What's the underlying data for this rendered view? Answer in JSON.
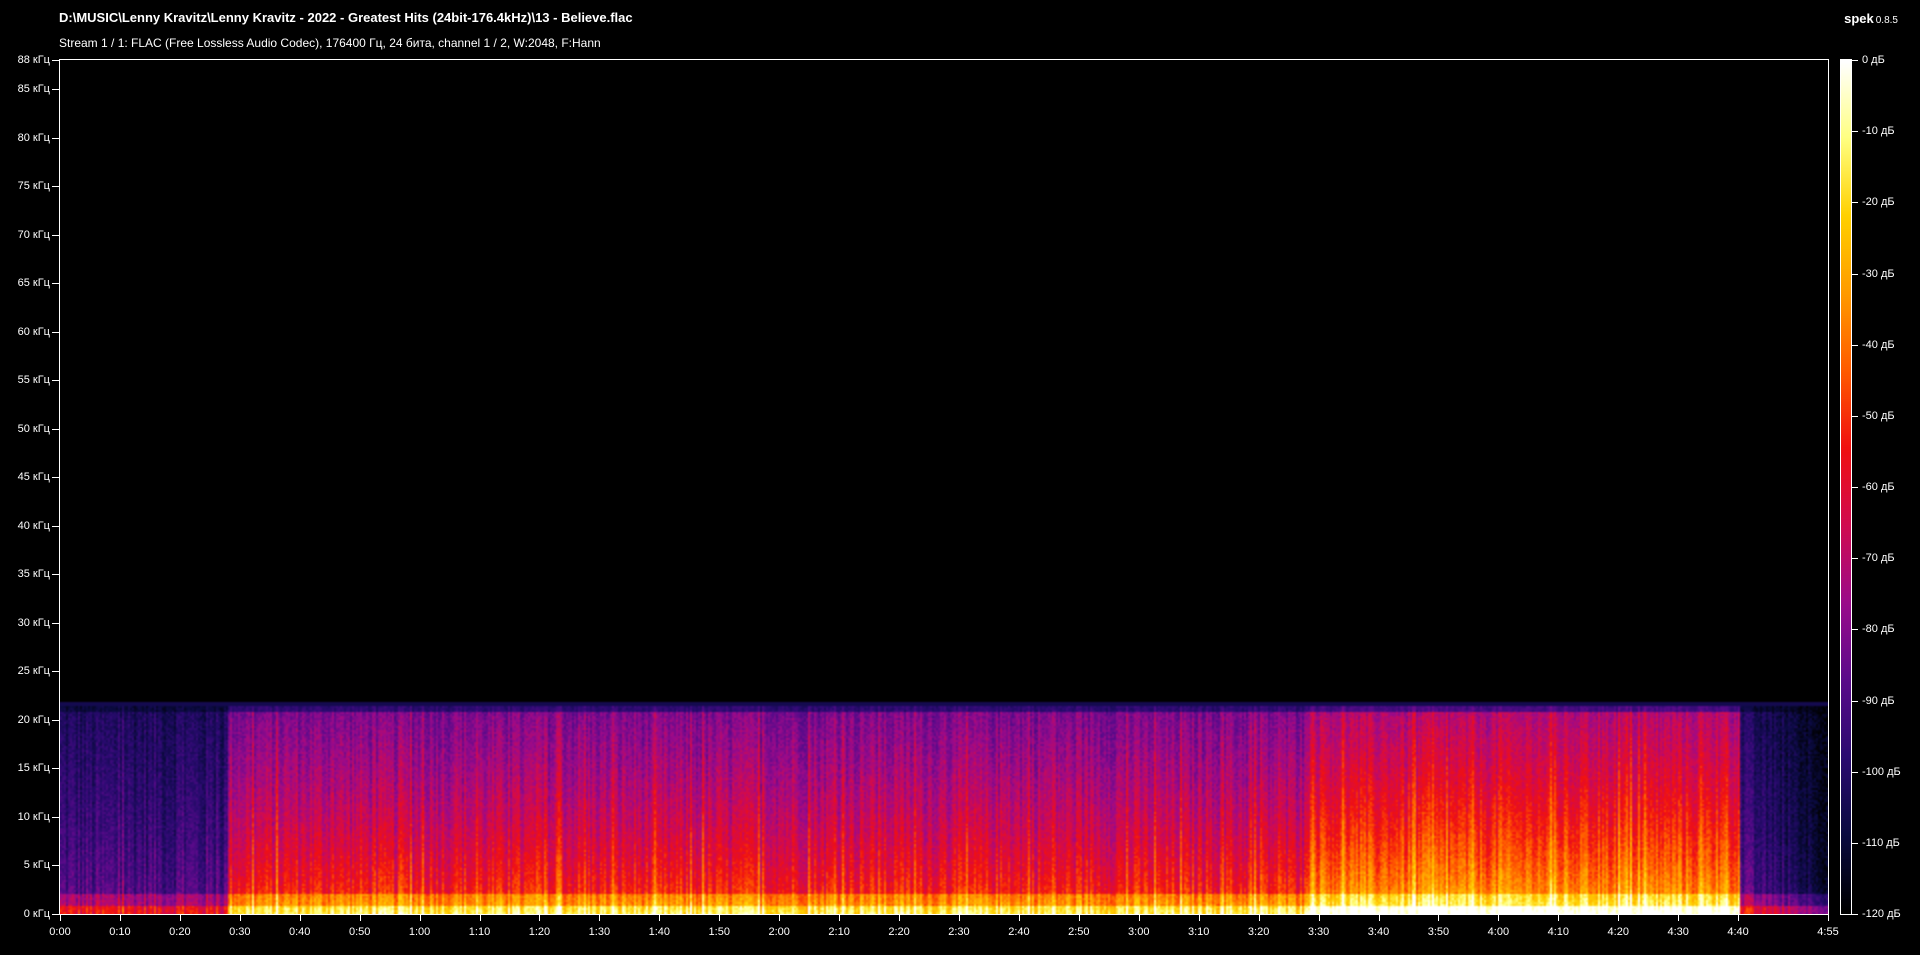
{
  "window": {
    "title": "D:\\MUSIC\\Lenny Kravitz\\Lenny Kravitz - 2022 - Greatest Hits (24bit-176.4kHz)\\13 - Believe.flac",
    "stream_info": "Stream 1 / 1: FLAC (Free Lossless Audio Codec), 176400 Гц, 24 бита, channel 1 / 2, W:2048, F:Hann"
  },
  "brand": {
    "name": "spek",
    "version": "0.8.5"
  },
  "chart_data": {
    "type": "heatmap",
    "title": "",
    "freq_axis": {
      "unit": "kHz",
      "max": 88,
      "labels": [
        "88 кГц",
        "85 кГц",
        "80 кГц",
        "75 кГц",
        "70 кГц",
        "65 кГц",
        "60 кГц",
        "55 кГц",
        "50 кГц",
        "45 кГц",
        "40 кГц",
        "35 кГц",
        "30 кГц",
        "25 кГц",
        "20 кГц",
        "15 кГц",
        "10 кГц",
        "5 кГц",
        "0 кГц"
      ],
      "values": [
        88,
        85,
        80,
        75,
        70,
        65,
        60,
        55,
        50,
        45,
        40,
        35,
        30,
        25,
        20,
        15,
        10,
        5,
        0
      ]
    },
    "time_axis": {
      "unit": "s",
      "duration_seconds": 295,
      "labels": [
        "0:00",
        "0:10",
        "0:20",
        "0:30",
        "0:40",
        "0:50",
        "1:00",
        "1:10",
        "1:20",
        "1:30",
        "1:40",
        "1:50",
        "2:00",
        "2:10",
        "2:20",
        "2:30",
        "2:40",
        "2:50",
        "3:00",
        "3:10",
        "3:20",
        "3:30",
        "3:40",
        "3:50",
        "4:00",
        "4:10",
        "4:20",
        "4:30",
        "4:40",
        "4:55"
      ],
      "values": [
        0,
        10,
        20,
        30,
        40,
        50,
        60,
        70,
        80,
        90,
        100,
        110,
        120,
        130,
        140,
        150,
        160,
        170,
        180,
        190,
        200,
        210,
        220,
        230,
        240,
        250,
        260,
        270,
        280,
        295
      ]
    },
    "level_axis": {
      "unit": "dB",
      "labels": [
        "0 дБ",
        "-10 дБ",
        "-20 дБ",
        "-30 дБ",
        "-40 дБ",
        "-50 дБ",
        "-60 дБ",
        "-70 дБ",
        "-80 дБ",
        "-90 дБ",
        "-100 дБ",
        "-110 дБ",
        "-120 дБ"
      ],
      "values": [
        0,
        -10,
        -20,
        -30,
        -40,
        -50,
        -60,
        -70,
        -80,
        -90,
        -100,
        -110,
        -120
      ]
    },
    "colormap": [
      "#000000",
      "#0a0a40",
      "#2a0a70",
      "#5a0a8a",
      "#9a0a8a",
      "#d00a50",
      "#f01010",
      "#ff5a00",
      "#ff9a00",
      "#ffd000",
      "#ffff80",
      "#ffffff"
    ],
    "energy_cutoff_khz": 21.5,
    "segments": [
      {
        "start": 0,
        "end": 28,
        "level": 0.28
      },
      {
        "start": 28,
        "end": 208,
        "level": 0.62
      },
      {
        "start": 208,
        "end": 280,
        "level": 0.78
      },
      {
        "start": 280,
        "end": 295,
        "level": 0.3
      }
    ]
  }
}
